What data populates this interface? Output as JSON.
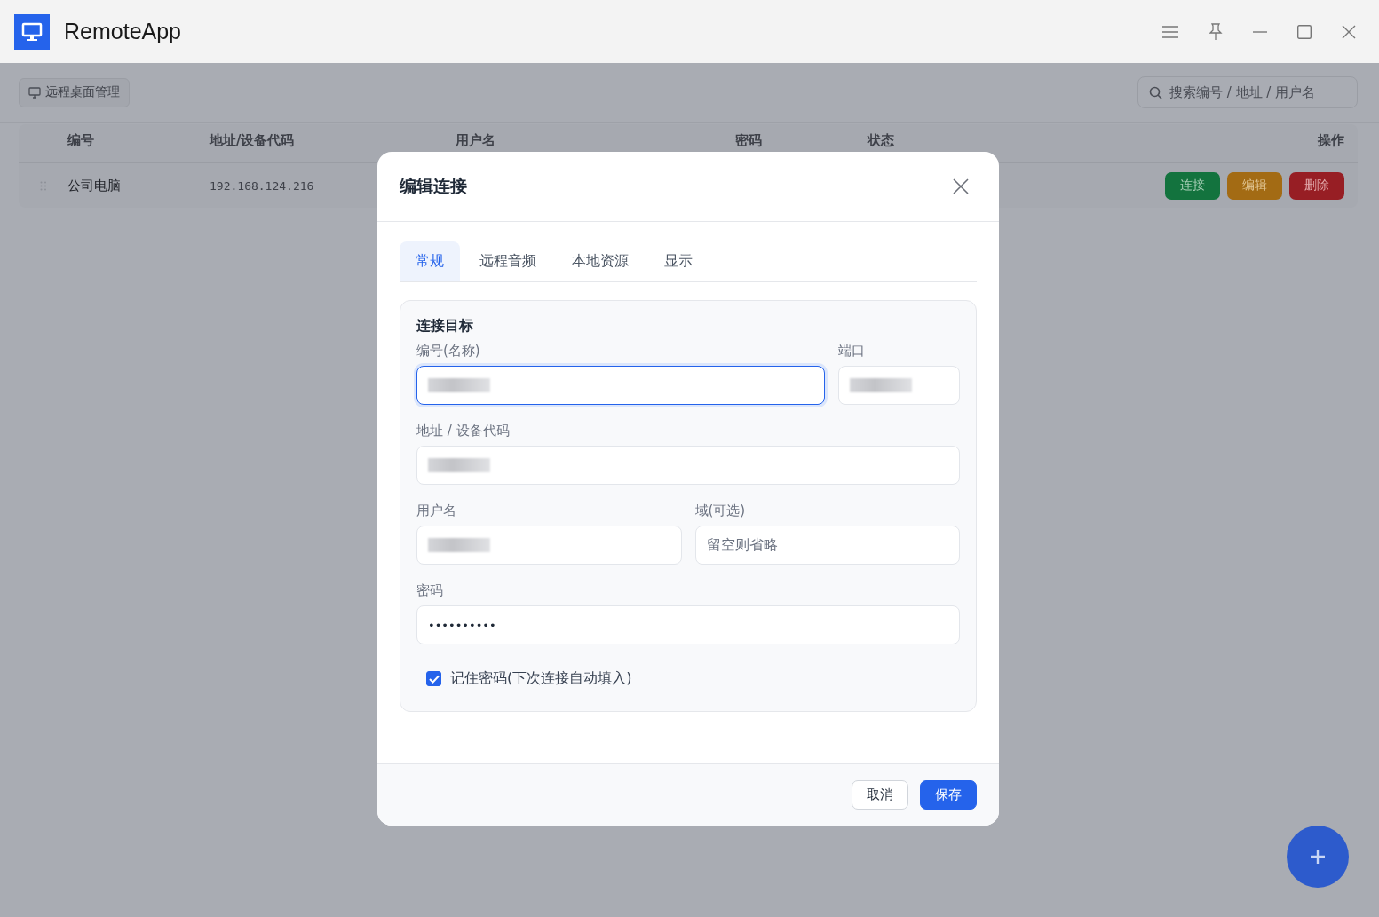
{
  "window": {
    "title": "RemoteApp"
  },
  "toolbar": {
    "button": "远程桌面管理",
    "search": {
      "placeholder": "搜索编号 / 地址 / 用户名"
    }
  },
  "table": {
    "columns": [
      "编号",
      "地址/设备代码",
      "用户名",
      "密码",
      "状态",
      "操作"
    ],
    "rows": [
      {
        "name": "公司电脑",
        "address": "192.168.124.216",
        "actions": [
          {
            "label": "连接",
            "kind": "connect"
          },
          {
            "label": "编辑",
            "kind": "edit"
          },
          {
            "label": "删除",
            "kind": "delete"
          }
        ]
      }
    ]
  },
  "dialog": {
    "title": "编辑连接",
    "tabs": [
      {
        "label": "常规",
        "selected": true
      },
      {
        "label": "远程音频",
        "selected": false
      },
      {
        "label": "本地资源",
        "selected": false
      },
      {
        "label": "显示",
        "selected": false
      }
    ],
    "section": "连接目标",
    "fields": [
      {
        "label": "编号(名称)",
        "redacted": true,
        "focused": true
      },
      {
        "label": "端口",
        "redacted": true,
        "focused": false
      },
      {
        "label": "地址 / 设备代码",
        "redacted": true,
        "focused": false
      },
      {
        "label": "用户名",
        "redacted": true,
        "focused": false
      },
      {
        "label": "域(可选)",
        "placeholder": "留空则省略",
        "focused": false
      },
      {
        "label": "密码",
        "value": "••••••••••",
        "focused": false
      }
    ],
    "remember": {
      "label": "记住密码(下次连接自动填入)",
      "checked": true
    },
    "buttons": [
      {
        "label": "取消",
        "kind": "secondary"
      },
      {
        "label": "保存",
        "kind": "primary"
      }
    ]
  }
}
